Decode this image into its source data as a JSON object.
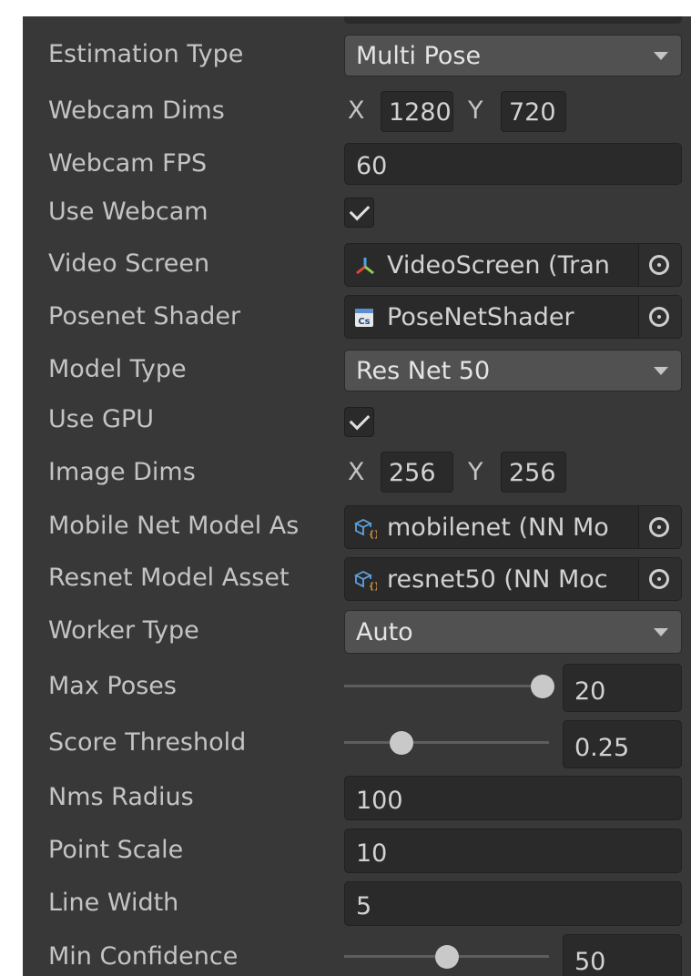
{
  "inspector": {
    "estimation_type": {
      "label": "Estimation Type",
      "value": "Multi Pose"
    },
    "webcam_dims": {
      "label": "Webcam Dims",
      "x_axis": "X",
      "y_axis": "Y",
      "x": "1280",
      "y": "720"
    },
    "webcam_fps": {
      "label": "Webcam FPS",
      "value": "60"
    },
    "use_webcam": {
      "label": "Use Webcam",
      "checked": true
    },
    "video_screen": {
      "label": "Video Screen",
      "value": "VideoScreen (Tran",
      "icon": "transform-icon"
    },
    "posenet_shader": {
      "label": "Posenet Shader",
      "value": "PoseNetShader",
      "icon": "cs-script-icon"
    },
    "model_type": {
      "label": "Model Type",
      "value": "Res Net 50"
    },
    "use_gpu": {
      "label": "Use GPU",
      "checked": true
    },
    "image_dims": {
      "label": "Image Dims",
      "x_axis": "X",
      "y_axis": "Y",
      "x": "256",
      "y": "256"
    },
    "mobile_net_model_asset": {
      "label": "Mobile Net Model As",
      "value": "mobilenet (NN Mo",
      "icon": "nn-model-icon"
    },
    "resnet_model_asset": {
      "label": "Resnet Model Asset",
      "value": "resnet50 (NN Moc",
      "icon": "nn-model-icon"
    },
    "worker_type": {
      "label": "Worker Type",
      "value": "Auto"
    },
    "max_poses": {
      "label": "Max Poses",
      "value": "20",
      "slider_fraction": 0.97
    },
    "score_threshold": {
      "label": "Score Threshold",
      "value": "0.25",
      "slider_fraction": 0.28
    },
    "nms_radius": {
      "label": "Nms Radius",
      "value": "100"
    },
    "point_scale": {
      "label": "Point Scale",
      "value": "10"
    },
    "line_width": {
      "label": "Line Width",
      "value": "5"
    },
    "min_confidence": {
      "label": "Min Confidence",
      "value": "50",
      "slider_fraction": 0.5
    }
  },
  "colors": {
    "panel_bg": "#383838",
    "field_bg": "#2a2a2a",
    "dropdown_bg": "#515151",
    "label_text": "#c4c4c4",
    "transform_icon_red": "#e0483a",
    "transform_icon_green": "#8fd14f",
    "transform_icon_blue": "#4aa3e8",
    "nn_model_icon": "#5ea3e0"
  }
}
